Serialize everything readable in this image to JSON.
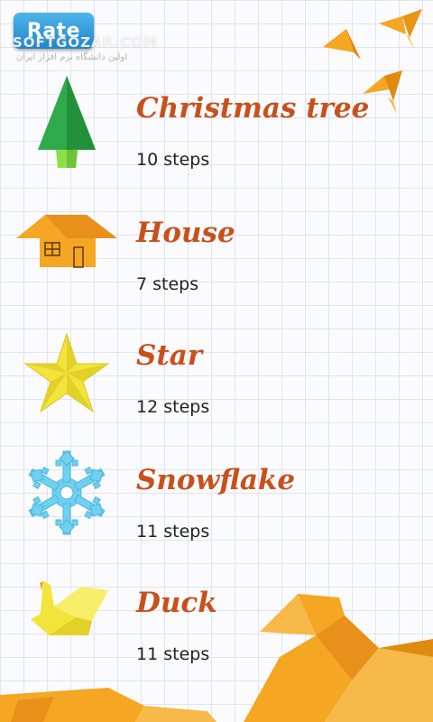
{
  "header": {
    "rate_label": "Rate"
  },
  "watermark": {
    "text": "SOFTGOZAR.COM",
    "subtext": "اولین دانشگاه نرم افزار ایران"
  },
  "projects": [
    {
      "title": "Christmas tree",
      "steps": "10 steps",
      "icon": "christmas-tree-icon"
    },
    {
      "title": "House",
      "steps": "7 steps",
      "icon": "house-icon"
    },
    {
      "title": "Star",
      "steps": "12 steps",
      "icon": "star-icon"
    },
    {
      "title": "Snowflake",
      "steps": "11 steps",
      "icon": "snowflake-icon"
    },
    {
      "title": "Duck",
      "steps": "11 steps",
      "icon": "duck-icon"
    }
  ],
  "colors": {
    "title": "#c8501c",
    "rate_button": "#2c95d8",
    "origami_orange": "#f5a623",
    "origami_green": "#2eaa4a",
    "origami_yellow": "#f2e43a",
    "snowflake_blue": "#6fd0f0"
  }
}
